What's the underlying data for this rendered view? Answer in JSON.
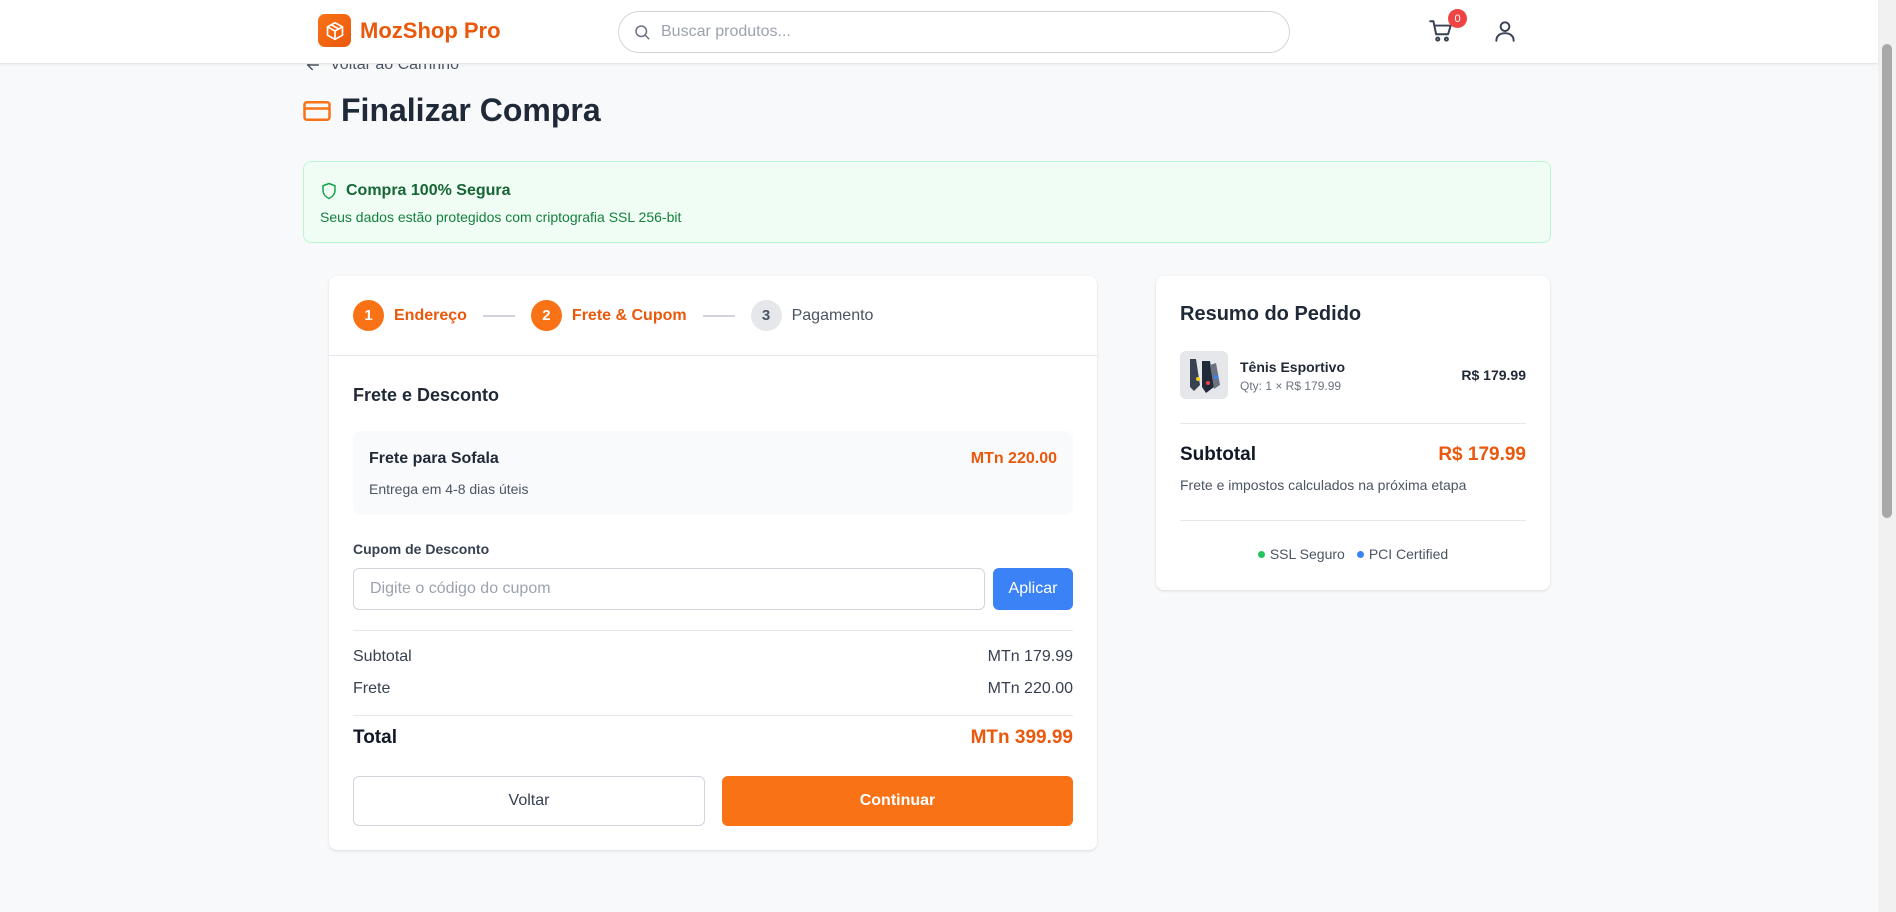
{
  "header": {
    "brand": "MozShop Pro",
    "search_placeholder": "Buscar produtos...",
    "cart_count": "0",
    "icons": [
      "logo-box-icon",
      "search-icon",
      "cart-icon",
      "user-icon"
    ]
  },
  "back_link": "Voltar ao Carrinho",
  "page_title": "Finalizar Compra",
  "secure": {
    "title": "Compra 100% Segura",
    "subtitle": "Seus dados estão protegidos com criptografia SSL 256-bit"
  },
  "steps": [
    {
      "num": "1",
      "label": "Endereço"
    },
    {
      "num": "2",
      "label": "Frete & Cupom"
    },
    {
      "num": "3",
      "label": "Pagamento"
    }
  ],
  "shipping": {
    "section_title": "Frete e Desconto",
    "name": "Frete para Sofala",
    "price": "MTn 220.00",
    "time": "Entrega em 4-8 dias úteis"
  },
  "coupon": {
    "label": "Cupom de Desconto",
    "placeholder": "Digite o código do cupom",
    "apply": "Aplicar"
  },
  "totals": {
    "subtotal_label": "Subtotal",
    "subtotal_value": "MTn 179.99",
    "shipping_label": "Frete",
    "shipping_value": "MTn 220.00",
    "total_label": "Total",
    "total_value": "MTn 399.99"
  },
  "actions": {
    "back": "Voltar",
    "continue": "Continuar"
  },
  "summary": {
    "title": "Resumo do Pedido",
    "item_name": "Tênis Esportivo",
    "item_qty": "Qty: 1 × R$ 179.99",
    "item_price": "R$ 179.99",
    "subtotal_label": "Subtotal",
    "subtotal_value": "R$ 179.99",
    "note": "Frete e impostos calculados na próxima etapa",
    "badge_ssl": "SSL Seguro",
    "badge_pci": "PCI Certified"
  },
  "colors": {
    "accent": "#f97316",
    "accent_text": "#ea580c",
    "apply_blue": "#3b82f6",
    "secure_green": "#166534",
    "ssl_dot": "#22c55e",
    "pci_dot": "#3b82f6"
  }
}
